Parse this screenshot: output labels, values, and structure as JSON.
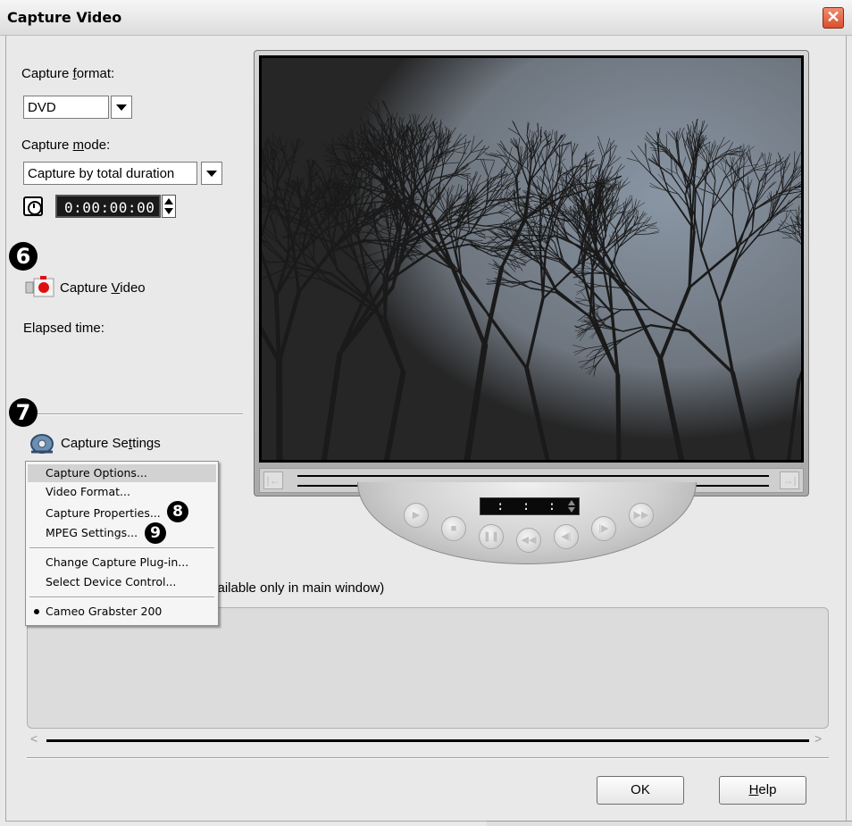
{
  "window": {
    "title": "Capture Video",
    "close_glyph": "✕"
  },
  "capture_format": {
    "label_pre": "Capture ",
    "label_ul": "f",
    "label_post": "ormat:",
    "value": "DVD"
  },
  "capture_mode": {
    "label_pre": "Capture ",
    "label_ul": "m",
    "label_post": "ode:",
    "value": "Capture by total duration"
  },
  "timer": {
    "value": "0:00:00:00"
  },
  "callouts": {
    "c6": "6",
    "c7": "7",
    "c8": "8",
    "c9": "9"
  },
  "capture_video": {
    "label_pre": "Capture ",
    "label_ul": "V",
    "label_post": "ideo"
  },
  "elapsed": {
    "label": "Elapsed time:"
  },
  "capture_settings": {
    "label_pre": "Capture Se",
    "label_ul": "t",
    "label_post": "tings"
  },
  "menu": {
    "items": [
      {
        "label": "Capture Options...",
        "highlighted": true
      },
      {
        "label": "Video Format..."
      },
      {
        "label": "Capture Properties..."
      },
      {
        "label": "MPEG Settings..."
      },
      {
        "label": "Change Capture Plug-in..."
      },
      {
        "label": "Select Device Control..."
      },
      {
        "label": "Cameo Grabster 200",
        "selected": true
      }
    ]
  },
  "preview": {
    "timecode": ": : :"
  },
  "capture_source_note": "vailable only in main window)",
  "buttons": {
    "ok": "OK",
    "help_ul": "H",
    "help_rest": "elp"
  },
  "colors": {
    "close": "#d8502e",
    "menu_highlight": "#d2d2d2",
    "panel": "#dcdcdc",
    "sky": "#aebfd2"
  }
}
